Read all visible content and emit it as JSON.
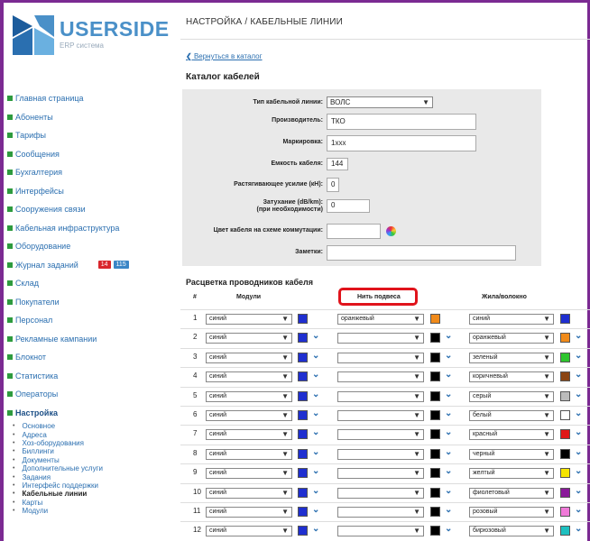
{
  "app": {
    "logo_text": "USERSIDE",
    "logo_sub": "ERP система"
  },
  "sidebar": {
    "items": [
      {
        "label": "Главная страница",
        "icon": "home-icon"
      },
      {
        "label": "Абоненты",
        "icon": "users-icon"
      },
      {
        "label": "Тарифы",
        "icon": "tariff-icon"
      },
      {
        "label": "Сообщения",
        "icon": "message-icon"
      },
      {
        "label": "Бухгалтерия",
        "icon": "accounting-icon"
      },
      {
        "label": "Интерфейсы",
        "icon": "interface-icon"
      },
      {
        "label": "Сооружения связи",
        "icon": "building-icon"
      },
      {
        "label": "Кабельная инфраструктура",
        "icon": "cable-icon"
      },
      {
        "label": "Оборудование",
        "icon": "device-icon"
      },
      {
        "label": "Журнал заданий",
        "icon": "tasks-icon",
        "badges": [
          "14",
          "115"
        ]
      },
      {
        "label": "Склад",
        "icon": "warehouse-icon"
      },
      {
        "label": "Покупатели",
        "icon": "buyers-icon"
      },
      {
        "label": "Персонал",
        "icon": "staff-icon"
      },
      {
        "label": "Рекламные кампании",
        "icon": "ads-icon"
      },
      {
        "label": "Блокнот",
        "icon": "notepad-icon"
      },
      {
        "label": "Статистика",
        "icon": "stats-icon"
      },
      {
        "label": "Операторы",
        "icon": "operators-icon"
      },
      {
        "label": "Настройка",
        "icon": "settings-icon"
      }
    ],
    "sub_items": [
      "Основное",
      "Адреса",
      "Хоз-оборудования",
      "Биллинги",
      "Документы",
      "Дополнительные услуги",
      "Задания",
      "Интерфейс поддержки",
      "Кабельные линии",
      "Карты",
      "Модули"
    ],
    "badge_colors": [
      "#d9262c",
      "#3b86c6"
    ]
  },
  "header": {
    "breadcrumb": "НАСТРОЙКА / КАБЕЛЬНЫЕ ЛИНИИ",
    "back_link": "Вернуться в каталог",
    "section_title": "Каталог кабелей"
  },
  "form": {
    "type_label": "Тип кабельной линии:",
    "type_value": "ВОЛС",
    "manufacturer_label": "Производитель:",
    "manufacturer_value": "ТКО",
    "marking_label": "Маркировка:",
    "marking_value": "1ххх",
    "capacity_label": "Емкость кабеля:",
    "capacity_value": "144",
    "tension_label": "Растягивающее усилие (кН):",
    "tension_value": "0",
    "attenuation_label": "Затухание (dB/km):",
    "attenuation_sub": "(при необходимости)",
    "attenuation_value": "0",
    "color_label": "Цвет кабеля на схеме коммутации:",
    "notes_label": "Заметки:"
  },
  "table": {
    "title": "Расцветка проводников кабеля",
    "col_num": "#",
    "col_module": "Модули",
    "col_thread": "Нить подвеса",
    "col_core": "Жила/волокно",
    "rows": [
      {
        "n": "1",
        "module": "синий",
        "module_color": "#1f2fd0",
        "thread": "оранжевый",
        "thread_color": "#f08a1a",
        "core": "синий",
        "core_color": "#1f2fd0"
      },
      {
        "n": "2",
        "module": "синий",
        "module_color": "#1f2fd0",
        "thread": "",
        "thread_color": "#000000",
        "core": "оранжевый",
        "core_color": "#f08a1a"
      },
      {
        "n": "3",
        "module": "синий",
        "module_color": "#1f2fd0",
        "thread": "",
        "thread_color": "#000000",
        "core": "зеленый",
        "core_color": "#2ec52e"
      },
      {
        "n": "4",
        "module": "синий",
        "module_color": "#1f2fd0",
        "thread": "",
        "thread_color": "#000000",
        "core": "коричневый",
        "core_color": "#8b4513"
      },
      {
        "n": "5",
        "module": "синий",
        "module_color": "#1f2fd0",
        "thread": "",
        "thread_color": "#000000",
        "core": "серый",
        "core_color": "#bbbbbb"
      },
      {
        "n": "6",
        "module": "синий",
        "module_color": "#1f2fd0",
        "thread": "",
        "thread_color": "#000000",
        "core": "белый",
        "core_color": "#ffffff"
      },
      {
        "n": "7",
        "module": "синий",
        "module_color": "#1f2fd0",
        "thread": "",
        "thread_color": "#000000",
        "core": "красный",
        "core_color": "#e01818"
      },
      {
        "n": "8",
        "module": "синий",
        "module_color": "#1f2fd0",
        "thread": "",
        "thread_color": "#000000",
        "core": "черный",
        "core_color": "#000000"
      },
      {
        "n": "9",
        "module": "синий",
        "module_color": "#1f2fd0",
        "thread": "",
        "thread_color": "#000000",
        "core": "желтый",
        "core_color": "#f5e400"
      },
      {
        "n": "10",
        "module": "синий",
        "module_color": "#1f2fd0",
        "thread": "",
        "thread_color": "#000000",
        "core": "фиолетовый",
        "core_color": "#8a1a9a"
      },
      {
        "n": "11",
        "module": "синий",
        "module_color": "#1f2fd0",
        "thread": "",
        "thread_color": "#000000",
        "core": "розовый",
        "core_color": "#f07ad8"
      },
      {
        "n": "12",
        "module": "синий",
        "module_color": "#1f2fd0",
        "thread": "",
        "thread_color": "#000000",
        "core": "бирюзовый",
        "core_color": "#1ec0c0"
      }
    ]
  },
  "colors": {
    "frame": "#7b2a92",
    "link": "#2b6fb0",
    "highlight": "#e0131b",
    "nav_icon": "#2e9b3e"
  }
}
